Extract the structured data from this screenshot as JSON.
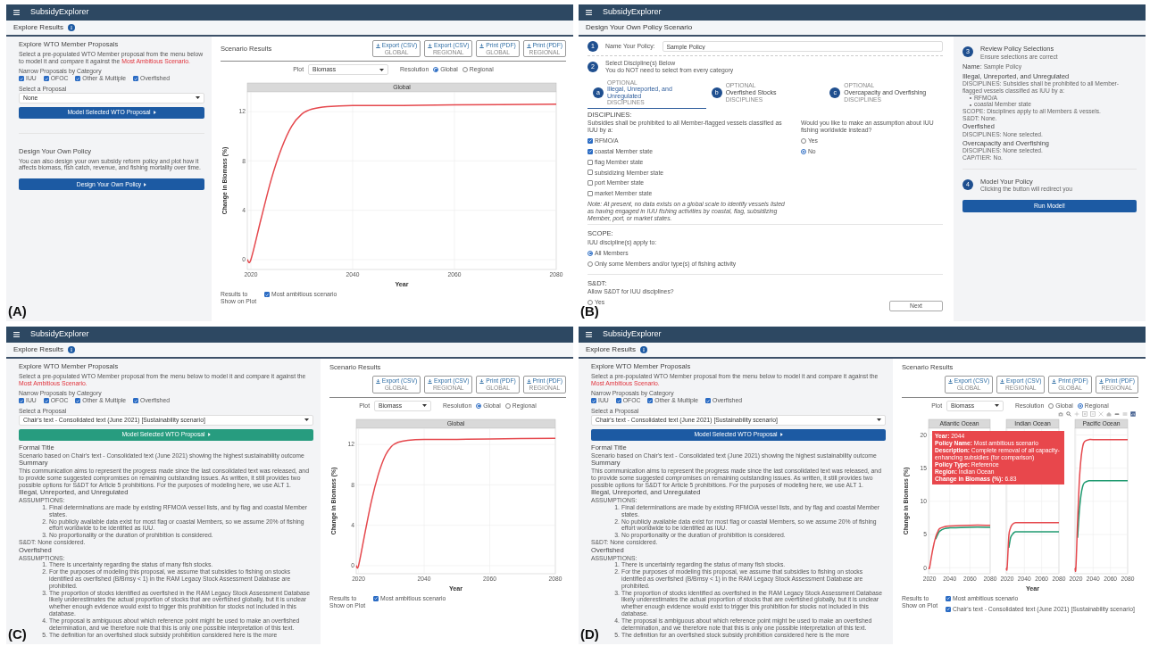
{
  "panels": [
    {
      "label": "(A)",
      "kind": "explore",
      "navbar": {
        "title": "SubsidyExplorer"
      },
      "header": {
        "title": "Explore Results",
        "info": true
      },
      "sidebar": {
        "title": "Explore WTO Member Proposals",
        "intro": "Select a pre-populated WTO Member proposal from the menu below to model it and compare it against the",
        "intro_link": "Most Ambitious Scenario.",
        "filter_label": "Narrow Proposals by Category",
        "categories": [
          {
            "label": "IUU",
            "checked": true
          },
          {
            "label": "OFOC",
            "checked": true
          },
          {
            "label": "Other & Multiple",
            "checked": true
          },
          {
            "label": "Overfished",
            "checked": true
          }
        ],
        "select_label": "Select a Proposal",
        "select_value": "None",
        "model_button": {
          "label": "Model Selected WTO Proposal",
          "hovered": false
        },
        "design": {
          "title": "Design Your Own Policy",
          "text": "You can also design your own subsidy reform policy and plot how it affects biomass, fish catch, revenue, and fishing mortality over time.",
          "button": "Design Your Own Policy"
        }
      },
      "results": {
        "title": "Scenario Results",
        "exports": [
          {
            "label": "Export (CSV)",
            "sublabel": "GLOBAL"
          },
          {
            "label": "Export (CSV)",
            "sublabel": "REGIONAL"
          },
          {
            "label": "Print (PDF)",
            "sublabel": "GLOBAL"
          },
          {
            "label": "Print (PDF)",
            "sublabel": "REGIONAL"
          }
        ],
        "plot_label": "Plot",
        "plot_value": "Biomass",
        "resolution_label": "Resolution",
        "resolutions": [
          {
            "label": "Global",
            "selected": true
          },
          {
            "label": "Regional",
            "selected": false
          }
        ],
        "facets": [
          {
            "chart_data": {
              "type": "line",
              "title": "Global",
              "xlabel": "Year",
              "ylabel": "Change in Biomass (%)",
              "grid": true,
              "x": [
                2019.3,
                2020,
                2022,
                2024,
                2026,
                2028,
                2030,
                2032,
                2035,
                2040,
                2050,
                2060,
                2080
              ],
              "xlim": [
                2019.3,
                2080
              ],
              "ylim": [
                -0.8,
                13.6
              ],
              "xticks": [
                2020,
                2040,
                2060,
                2080
              ],
              "yticks": [
                0,
                4,
                8,
                12
              ],
              "series": [
                {
                  "name": "Most ambitious scenario",
                  "color": "#e5484d",
                  "values": [
                    0,
                    0,
                    3.3,
                    6.5,
                    9.0,
                    10.8,
                    11.8,
                    12.2,
                    12.4,
                    12.5,
                    12.5,
                    12.55,
                    12.6
                  ]
                }
              ]
            }
          }
        ],
        "show_label": "Results to Show on Plot",
        "shown": [
          {
            "checked": true
          }
        ]
      }
    },
    {
      "label": "(B)",
      "kind": "design",
      "navbar": {
        "title": "SubsidyExplorer"
      },
      "header": {
        "title": "Design Your Own Policy Scenario"
      },
      "name_step": {
        "number": "1",
        "label": "Name Your Policy:",
        "value": "Sample Policy"
      },
      "discipline_step": {
        "number": "2",
        "title": "Select Discipline(s) Below",
        "subtitle": "You do NOT need to select from every category"
      },
      "tabs": [
        {
          "letter": "a",
          "eyebrow": "OPTIONAL",
          "title": "Illegal, Unreported, and Unregulated",
          "caption": "DISCIPLINES",
          "selected": true
        },
        {
          "letter": "b",
          "eyebrow": "OPTIONAL",
          "title": "Overfished Stocks",
          "caption": "DISCIPLINES",
          "selected": false
        },
        {
          "letter": "c",
          "eyebrow": "OPTIONAL",
          "title": "Overcapacity and Overfishing",
          "caption": "DISCIPLINES",
          "selected": false
        }
      ],
      "disciplines": {
        "heading": "DISCIPLINES:",
        "prompt": "Subsidies shall be prohibited to all Member-flagged vessels classified as IUU by a:",
        "options": [
          {
            "label": "RFMO/A",
            "checked": true
          },
          {
            "label": "coastal Member state",
            "checked": true
          },
          {
            "label": "flag Member state",
            "checked": false
          },
          {
            "label": "subsidizing Member state",
            "checked": false
          },
          {
            "label": "port Member state",
            "checked": false
          },
          {
            "label": "market Member state",
            "checked": false
          }
        ],
        "note": "Note: At present, no data exists on a global scale to identify vessels listed as having engaged in IUU fishing activities by coastal, flag, subsidizing Member, port, or market states.",
        "question": "Would you like to make an assumption about IUU fishing worldwide instead?",
        "answers": [
          {
            "label": "Yes",
            "selected": false
          },
          {
            "label": "No",
            "selected": true
          }
        ]
      },
      "scope": {
        "heading": "SCOPE:",
        "prompt": "IUU discipline(s) apply to:",
        "options": [
          {
            "label": "All Members",
            "selected": true
          },
          {
            "label": "Only some Members and/or type(s) of fishing activity",
            "selected": false
          }
        ]
      },
      "sdt": {
        "heading": "S&DT:",
        "prompt": "Allow S&DT for IUU disciplines?",
        "options": [
          {
            "label": "Yes",
            "selected": false
          }
        ]
      },
      "next_button": "Next",
      "review": {
        "number": "3",
        "title": "Review Policy Selections",
        "subtitle": "Ensure selections are correct",
        "name_label": "Name:",
        "name_value": "Sample Policy",
        "sections": [
          {
            "heading": "Illegal, Unreported, and Unregulated",
            "lines": [
              {
                "kind": "text",
                "text": "DISCIPLINES: Subsidies shall be prohibited to all Member-flagged vessels classified as IUU by a:"
              },
              {
                "kind": "bullet",
                "text": "RFMO/A"
              },
              {
                "kind": "bullet",
                "text": "coastal Member state"
              },
              {
                "kind": "text",
                "text": "SCOPE: Disciplines apply to all Members & vessels."
              },
              {
                "kind": "text",
                "text": "S&DT: None."
              }
            ]
          },
          {
            "heading": "Overfished",
            "lines": [
              {
                "kind": "text",
                "text": "DISCIPLINES: None selected."
              }
            ]
          },
          {
            "heading": "Overcapacity and Overfishing",
            "lines": [
              {
                "kind": "text",
                "text": "DISCIPLINES: None selected."
              },
              {
                "kind": "text",
                "text": "CAP/TIER: No."
              }
            ]
          }
        ]
      },
      "model_step": {
        "number": "4",
        "title": "Model Your Policy",
        "subtitle": "Clicking the button will redirect you",
        "button": "Run Model!"
      }
    },
    {
      "label": "(C)",
      "kind": "explore",
      "navbar": {
        "title": "SubsidyExplorer"
      },
      "header": {
        "title": "Explore Results",
        "info": true
      },
      "sidebar": {
        "title": "Explore WTO Member Proposals",
        "intro": "Select a pre-populated WTO Member proposal from the menu below to model it and compare it against the",
        "intro_link": "Most Ambitious Scenario.",
        "filter_label": "Narrow Proposals by Category",
        "categories": [
          {
            "label": "IUU",
            "checked": true
          },
          {
            "label": "OFOC",
            "checked": true
          },
          {
            "label": "Other & Multiple",
            "checked": true
          },
          {
            "label": "Overfished",
            "checked": true
          }
        ],
        "select_label": "Select a Proposal",
        "select_value": "Chair's text - Consolidated text (June 2021) [Sustainability scenario]",
        "model_button": {
          "label": "Model Selected WTO Proposal",
          "hovered": true
        },
        "details": [
          {
            "kind": "heading",
            "text": "Formal Title"
          },
          {
            "kind": "text",
            "text": "Scenario based on Chair's text - Consolidated text (June 2021) showing the highest sustainability outcome"
          },
          {
            "kind": "heading",
            "text": "Summary"
          },
          {
            "kind": "text",
            "text": "This communication aims to represent the progress made since the last consolidated text was released, and to provide some suggested compromises on remaining outstanding issues. As written, it still provides two possible options for S&DT for Article 5 prohibitions. For the purposes of modeling here, we use ALT 1."
          },
          {
            "kind": "heading",
            "text": "Illegal, Unreported, and Unregulated"
          },
          {
            "kind": "caption",
            "text": "ASSUMPTIONS:"
          },
          {
            "kind": "list",
            "items": [
              {
                "number": "1.",
                "text": "Final determinations are made by existing RFMO/A vessel lists, and by flag and coastal Member states."
              },
              {
                "number": "2.",
                "text": "No publicly available data exist for most flag or coastal Members, so we assume 20% of fishing effort worldwide to be identified as IUU."
              },
              {
                "number": "3.",
                "text": "No proportionality or the duration of prohibition is considered."
              }
            ]
          },
          {
            "kind": "caption",
            "text": "S&DT: None considered."
          },
          {
            "kind": "heading",
            "text": "Overfished"
          },
          {
            "kind": "caption",
            "text": "ASSUMPTIONS:"
          },
          {
            "kind": "list",
            "items": [
              {
                "number": "1.",
                "text": "There is uncertainty regarding the status of many fish stocks."
              },
              {
                "number": "2.",
                "text": "For the purposes of modeling this proposal, we assume that subsidies to fishing on stocks identified as overfished (B/Bmsy < 1) in the RAM Legacy Stock Assessment Database are prohibited."
              },
              {
                "number": "3.",
                "text": "The proportion of stocks identified as overfished in the RAM Legacy Stock Assessment Database likely underestimates the actual proportion of stocks that are overfished globally, but it is unclear whether enough evidence would exist to trigger this prohibition for stocks not included in this database."
              },
              {
                "number": "4.",
                "text": "The proposal is ambiguous about which reference point might be used to make an overfished determination, and we therefore note that this is only one possible interpretation of this text."
              },
              {
                "number": "5.",
                "text": "The definition for an overfished stock subsidy prohibition considered here is the more"
              }
            ]
          }
        ]
      },
      "results": {
        "title": "Scenario Results",
        "exports": [
          {
            "label": "Export (CSV)",
            "sublabel": "GLOBAL"
          },
          {
            "label": "Export (CSV)",
            "sublabel": "REGIONAL"
          },
          {
            "label": "Print (PDF)",
            "sublabel": "GLOBAL"
          },
          {
            "label": "Print (PDF)",
            "sublabel": "REGIONAL"
          }
        ],
        "plot_label": "Plot",
        "plot_value": "Biomass",
        "resolution_label": "Resolution",
        "resolutions": [
          {
            "label": "Global",
            "selected": true
          },
          {
            "label": "Regional",
            "selected": false
          }
        ],
        "facets": [
          {
            "chart_data": {
              "type": "line",
              "title": "Global",
              "xlabel": "Year",
              "ylabel": "Change in Biomass (%)",
              "grid": true,
              "x": [
                2019.3,
                2020,
                2022,
                2024,
                2026,
                2028,
                2030,
                2032,
                2035,
                2040,
                2050,
                2060,
                2080
              ],
              "xlim": [
                2019.3,
                2080
              ],
              "ylim": [
                -0.8,
                13.6
              ],
              "xticks": [
                2020,
                2040,
                2060,
                2080
              ],
              "yticks": [
                0,
                4,
                8,
                12
              ],
              "series": [
                {
                  "name": "Most ambitious scenario",
                  "color": "#e5484d",
                  "values": [
                    0,
                    0,
                    3.3,
                    6.5,
                    9.0,
                    10.8,
                    11.8,
                    12.2,
                    12.4,
                    12.5,
                    12.5,
                    12.55,
                    12.6
                  ]
                }
              ]
            }
          }
        ],
        "show_label": "Results to Show on Plot",
        "shown": [
          {
            "checked": true
          }
        ]
      }
    },
    {
      "label": "(D)",
      "kind": "explore",
      "navbar": {
        "title": "SubsidyExplorer"
      },
      "header": {
        "title": "Explore Results",
        "info": true
      },
      "sidebar": {
        "title": "Explore WTO Member Proposals",
        "intro": "Select a pre-populated WTO Member proposal from the menu below to model it and compare it against the",
        "intro_link": "Most Ambitious Scenario.",
        "filter_label": "Narrow Proposals by Category",
        "categories": [
          {
            "label": "IUU",
            "checked": true
          },
          {
            "label": "OFOC",
            "checked": true
          },
          {
            "label": "Other & Multiple",
            "checked": true
          },
          {
            "label": "Overfished",
            "checked": true
          }
        ],
        "select_label": "Select a Proposal",
        "select_value": "Chair's text - Consolidated text (June 2021) [Sustainability scenario]",
        "model_button": {
          "label": "Model Selected WTO Proposal",
          "hovered": false
        },
        "details": [
          {
            "kind": "heading",
            "text": "Formal Title"
          },
          {
            "kind": "text",
            "text": "Scenario based on Chair's text - Consolidated text (June 2021) showing the highest sustainability outcome"
          },
          {
            "kind": "heading",
            "text": "Summary"
          },
          {
            "kind": "text",
            "text": "This communication aims to represent the progress made since the last consolidated text was released, and to provide some suggested compromises on remaining outstanding issues. As written, it still provides two possible options for S&DT for Article 5 prohibitions. For the purposes of modeling here, we use ALT 1."
          },
          {
            "kind": "heading",
            "text": "Illegal, Unreported, and Unregulated"
          },
          {
            "kind": "caption",
            "text": "ASSUMPTIONS:"
          },
          {
            "kind": "list",
            "items": [
              {
                "number": "1.",
                "text": "Final determinations are made by existing RFMO/A vessel lists, and by flag and coastal Member states."
              },
              {
                "number": "2.",
                "text": "No publicly available data exist for most flag or coastal Members, so we assume 20% of fishing effort worldwide to be identified as IUU."
              },
              {
                "number": "3.",
                "text": "No proportionality or the duration of prohibition is considered."
              }
            ]
          },
          {
            "kind": "caption",
            "text": "S&DT: None considered."
          },
          {
            "kind": "heading",
            "text": "Overfished"
          },
          {
            "kind": "caption",
            "text": "ASSUMPTIONS:"
          },
          {
            "kind": "list",
            "items": [
              {
                "number": "1.",
                "text": "There is uncertainty regarding the status of many fish stocks."
              },
              {
                "number": "2.",
                "text": "For the purposes of modeling this proposal, we assume that subsidies to fishing on stocks identified as overfished (B/Bmsy < 1) in the RAM Legacy Stock Assessment Database are prohibited."
              },
              {
                "number": "3.",
                "text": "The proportion of stocks identified as overfished in the RAM Legacy Stock Assessment Database likely underestimates the actual proportion of stocks that are overfished globally, but it is unclear whether enough evidence would exist to trigger this prohibition for stocks not included in this database."
              },
              {
                "number": "4.",
                "text": "The proposal is ambiguous about which reference point might be used to make an overfished determination, and we therefore note that this is only one possible interpretation of this text."
              },
              {
                "number": "5.",
                "text": "The definition for an overfished stock subsidy prohibition considered here is the more"
              }
            ]
          }
        ]
      },
      "results": {
        "title": "Scenario Results",
        "exports": [
          {
            "label": "Export (CSV)",
            "sublabel": "GLOBAL"
          },
          {
            "label": "Export (CSV)",
            "sublabel": "REGIONAL"
          },
          {
            "label": "Print (PDF)",
            "sublabel": "GLOBAL"
          },
          {
            "label": "Print (PDF)",
            "sublabel": "REGIONAL"
          }
        ],
        "plot_label": "Plot",
        "plot_value": "Biomass",
        "resolution_label": "Resolution",
        "resolutions": [
          {
            "label": "Global",
            "selected": false
          },
          {
            "label": "Regional",
            "selected": true
          }
        ],
        "toolbar": true,
        "facets": [
          {
            "chart_data": {
              "type": "line",
              "title": "Atlantic Ocean",
              "ylabel": "Change in Biomass (%)",
              "grid": true,
              "x": [
                2019,
                2020,
                2022,
                2024,
                2026,
                2028,
                2030,
                2035,
                2040,
                2060,
                2080
              ],
              "xlim": [
                2019,
                2080
              ],
              "ylim": [
                -0.9,
                21
              ],
              "xticks": [
                2020,
                2040,
                2060,
                2080
              ],
              "yticks": [
                0,
                5,
                10,
                15,
                20
              ],
              "series": [
                {
                  "name": "Most ambitious scenario",
                  "color": "#e5484d",
                  "values": [
                    0,
                    0,
                    1.8,
                    3.4,
                    4.6,
                    5.4,
                    5.9,
                    6.2,
                    6.3,
                    6.4,
                    6.4
                  ]
                },
                {
                  "name": "Chair's text - Consolidated text (June 2021) [Sustainability scenario]",
                  "color": "#1f9a70",
                  "values": [
                    null,
                    null,
                    null,
                    null,
                    4.3,
                    5.0,
                    5.5,
                    5.9,
                    6.0,
                    6.1,
                    6.1
                  ]
                }
              ]
            }
          },
          {
            "chart_data": {
              "type": "line",
              "title": "Indian Ocean",
              "xlabel": "Year",
              "grid": true,
              "x": [
                2019,
                2020,
                2022,
                2024,
                2026,
                2028,
                2030,
                2035,
                2040,
                2060,
                2080
              ],
              "xlim": [
                2019,
                2080
              ],
              "ylim": [
                -0.9,
                21
              ],
              "xticks": [
                2020,
                2040,
                2060,
                2080
              ],
              "series": [
                {
                  "color": "#e5484d",
                  "values": [
                    0,
                    0,
                    4.8,
                    6.0,
                    6.5,
                    6.7,
                    6.8,
                    6.8,
                    6.8,
                    6.8,
                    6.8
                  ]
                },
                {
                  "color": "#1f9a70",
                  "values": [
                    null,
                    null,
                    3.0,
                    4.5,
                    5.0,
                    5.3,
                    5.4,
                    5.4,
                    5.4,
                    5.4,
                    5.4
                  ]
                }
              ]
            }
          },
          {
            "chart_data": {
              "type": "line",
              "title": "Pacific Ocean",
              "grid": true,
              "x": [
                2019,
                2020,
                2022,
                2024,
                2026,
                2028,
                2030,
                2035,
                2040,
                2060,
                2080
              ],
              "xlim": [
                2019,
                2080
              ],
              "ylim": [
                -0.9,
                21
              ],
              "xticks": [
                2020,
                2040,
                2060,
                2080
              ],
              "series": [
                {
                  "color": "#e5484d",
                  "values": [
                    0,
                    0,
                    7,
                    13,
                    16.5,
                    18.3,
                    19.0,
                    19.3,
                    19.3,
                    19.3,
                    19.3
                  ]
                },
                {
                  "color": "#1f9a70",
                  "values": [
                    null,
                    null,
                    4.5,
                    8.5,
                    11,
                    12.3,
                    12.8,
                    13.1,
                    13.1,
                    13.1,
                    13.1
                  ]
                }
              ]
            }
          }
        ],
        "tooltip": {
          "lines": [
            "**Year:** 2044",
            "**Policy Name:** Most ambitious scenario",
            "**Description:** Complete removal of all capacity-enhancing subsidies (for comparison)",
            "**Policy Type:** Reference",
            "**Region:** Indian Ocean",
            "**Change in Biomass (%):** 6.83"
          ]
        },
        "show_label": "Results to Show on Plot",
        "shown": [
          {
            "checked": true
          },
          {
            "checked": true
          }
        ]
      }
    }
  ]
}
